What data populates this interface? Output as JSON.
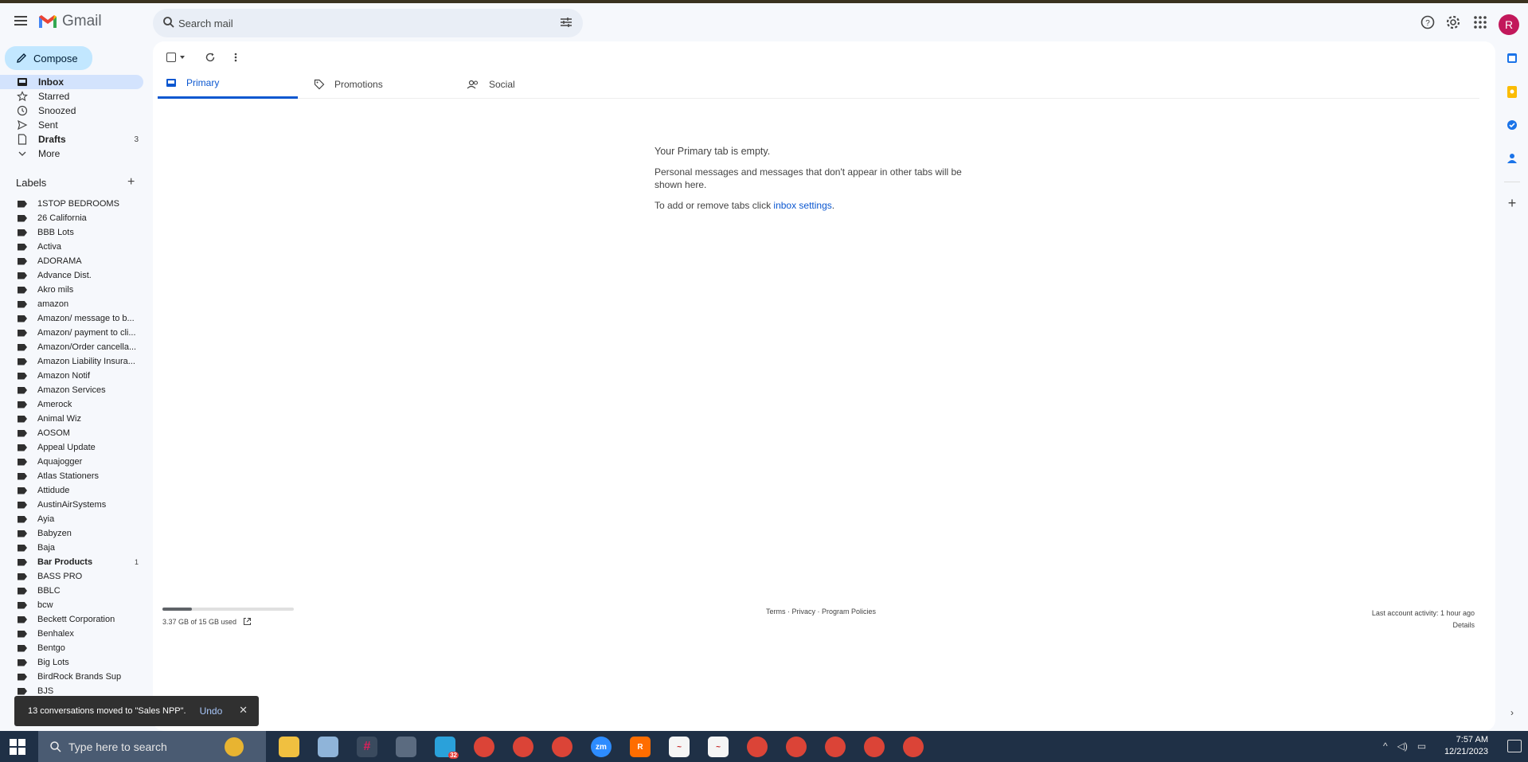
{
  "app": {
    "name": "Gmail",
    "search_placeholder": "Search mail",
    "avatar_letter": "R",
    "brand_color": "#ea4335"
  },
  "sidebar": {
    "compose_label": "Compose",
    "nav": [
      {
        "label": "Inbox",
        "count": "",
        "icon": "inbox-icon"
      },
      {
        "label": "Starred",
        "count": "",
        "icon": "star-icon"
      },
      {
        "label": "Snoozed",
        "count": "",
        "icon": "clock-icon"
      },
      {
        "label": "Sent",
        "count": "",
        "icon": "send-icon"
      },
      {
        "label": "Drafts",
        "count": "3",
        "icon": "draft-icon"
      },
      {
        "label": "More",
        "count": "",
        "icon": "chevron-down-icon"
      }
    ],
    "labels_heading": "Labels",
    "labels": [
      {
        "label": "1STOP BEDROOMS",
        "count": ""
      },
      {
        "label": "26 California",
        "count": ""
      },
      {
        "label": "BBB Lots",
        "count": ""
      },
      {
        "label": "Activa",
        "count": ""
      },
      {
        "label": "ADORAMA",
        "count": ""
      },
      {
        "label": "Advance Dist.",
        "count": ""
      },
      {
        "label": "Akro mils",
        "count": ""
      },
      {
        "label": "amazon",
        "count": ""
      },
      {
        "label": "Amazon/ message to b...",
        "count": ""
      },
      {
        "label": "Amazon/ payment to cli...",
        "count": ""
      },
      {
        "label": "Amazon/Order cancella...",
        "count": ""
      },
      {
        "label": "Amazon Liability Insura...",
        "count": ""
      },
      {
        "label": "Amazon Notif",
        "count": ""
      },
      {
        "label": "Amazon Services",
        "count": ""
      },
      {
        "label": "Amerock",
        "count": ""
      },
      {
        "label": "Animal Wiz",
        "count": ""
      },
      {
        "label": "AOSOM",
        "count": ""
      },
      {
        "label": "Appeal Update",
        "count": ""
      },
      {
        "label": "Aquajogger",
        "count": ""
      },
      {
        "label": "Atlas Stationers",
        "count": ""
      },
      {
        "label": "Attidude",
        "count": ""
      },
      {
        "label": "AustinAirSystems",
        "count": ""
      },
      {
        "label": "Ayia",
        "count": ""
      },
      {
        "label": "Babyzen",
        "count": ""
      },
      {
        "label": "Baja",
        "count": ""
      },
      {
        "label": "Bar Products",
        "count": "1"
      },
      {
        "label": "BASS PRO",
        "count": ""
      },
      {
        "label": "BBLC",
        "count": ""
      },
      {
        "label": "bcw",
        "count": ""
      },
      {
        "label": "Beckett Corporation",
        "count": ""
      },
      {
        "label": "Benhalex",
        "count": ""
      },
      {
        "label": "Bentgo",
        "count": ""
      },
      {
        "label": "Big Lots",
        "count": ""
      },
      {
        "label": "BirdRock Brands Sup",
        "count": ""
      },
      {
        "label": "BJS",
        "count": ""
      }
    ]
  },
  "main": {
    "tabs": [
      {
        "label": "Primary"
      },
      {
        "label": "Promotions"
      },
      {
        "label": "Social"
      }
    ],
    "empty_title": "Your Primary tab is empty.",
    "empty_body": "Personal messages and messages that don't appear in other tabs will be shown here.",
    "empty_settings_prefix": "To add or remove tabs click ",
    "empty_settings_link": "inbox settings",
    "empty_settings_suffix": ".",
    "storage_text": "3.37 GB of 15 GB used",
    "storage_fraction": 0.225,
    "footer_links": "Terms · Privacy · Program Policies",
    "last_activity": "Last account activity: 1 hour ago",
    "details": "Details"
  },
  "snackbar": {
    "message": "13 conversations moved to \"Sales NPP\".",
    "undo": "Undo"
  },
  "taskbar": {
    "search_placeholder": "Type here to search",
    "time": "7:57 AM",
    "date": "12/21/2023",
    "badge_count": "32"
  }
}
